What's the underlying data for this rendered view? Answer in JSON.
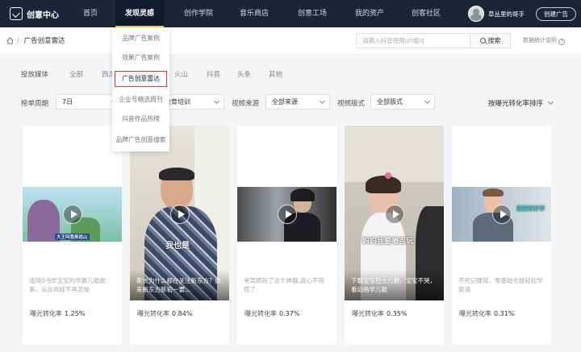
{
  "brand": {
    "name": "创意中心"
  },
  "nav": {
    "items": [
      "首页",
      "发现灵感",
      "创作学院",
      "音乐商店",
      "创意工场",
      "我的资产",
      "创客社区"
    ],
    "active_index": 1
  },
  "user": {
    "name": "草丛里的哥手",
    "ad_button": "创建广告"
  },
  "breadcrumb": {
    "separator": "/",
    "current": "广告创意雷达"
  },
  "search": {
    "placeholder": "请输入抖音视频url或id",
    "button": "搜索"
  },
  "stats_link": "数据统计说明",
  "filters": {
    "media_label": "投放媒体",
    "media_options": [
      "全部",
      "西瓜",
      "火山",
      "抖音",
      "头条",
      "其他"
    ],
    "period_label": "榜单周期",
    "period_value": "7日",
    "industry_value": "教育培训",
    "source_label": "视频来源",
    "source_value": "全部来源",
    "format_label": "视频版式",
    "format_value": "全部版式",
    "sort_value": "按曝光转化率排序"
  },
  "dropdown": {
    "items": [
      "品牌广告案例",
      "效果广告案例",
      "广告创意雷达",
      "企业号精选周刊",
      "抖音作品热榜",
      "品牌广告创意搜索"
    ],
    "selected_index": 2
  },
  "metric_label": "曝光转化率",
  "cards": [
    {
      "caption": "适用0-6岁宝宝的早教儿歌故事，从此哄娃不再苦恼",
      "rate": "1.25%",
      "overlay": "大王叫我来巡山"
    },
    {
      "caption": "家长为什么都在关注新东方？原来新东方新初一要...",
      "rate": "0.84%",
      "overlay": "我也是"
    },
    {
      "caption": "考驾照有了这个神器,真心不用慌了",
      "rate": "0.37%",
      "overlay": ""
    },
    {
      "caption": "下载宝宝巴士儿歌，宝宝不哭，看动画学儿歌",
      "rate": "0.35%",
      "overlay": "妈妈我要唱吉玩"
    },
    {
      "caption": "不死记硬背，零基础也能轻松学英语",
      "rate": "0.31%",
      "overlay": "我要好好学"
    }
  ]
}
